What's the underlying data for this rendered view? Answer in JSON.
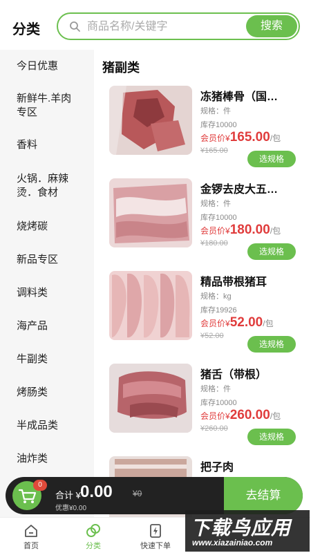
{
  "header": {
    "title": "分类",
    "search_placeholder": "商品名称/关键字",
    "search_button": "搜索"
  },
  "sidebar": {
    "items": [
      {
        "label": "今日优惠"
      },
      {
        "label": "新鲜牛.羊肉专区"
      },
      {
        "label": "香料"
      },
      {
        "label": "火锅．麻辣烫．食材"
      },
      {
        "label": "烧烤碳"
      },
      {
        "label": "新品专区"
      },
      {
        "label": "调料类"
      },
      {
        "label": "海产品"
      },
      {
        "label": "牛副类"
      },
      {
        "label": "烤肠类"
      },
      {
        "label": "半成品类"
      },
      {
        "label": "油炸类"
      }
    ]
  },
  "main": {
    "category_title": "猪副类",
    "products": [
      {
        "name": "冻猪棒骨（国…",
        "spec": "规格：件",
        "stock": "库存10000",
        "member_label": "会员价¥",
        "price": "165.00",
        "unit": "/包",
        "orig_price": "¥165.00",
        "spec_button": "选规格",
        "img_color": "#b8585a"
      },
      {
        "name": "金锣去皮大五…",
        "spec": "规格：件",
        "stock": "库存10000",
        "member_label": "会员价¥",
        "price": "180.00",
        "unit": "/包",
        "orig_price": "¥180.00",
        "spec_button": "选规格",
        "img_color": "#d9a0a4"
      },
      {
        "name": "精品带根猪耳",
        "spec": "规格：kg",
        "stock": "库存19926",
        "member_label": "会员价¥",
        "price": "52.00",
        "unit": "/包",
        "orig_price": "¥52.00",
        "spec_button": "选规格",
        "img_color": "#e6b6b6"
      },
      {
        "name": "猪舌（带根）",
        "spec": "规格：件",
        "stock": "库存10000",
        "member_label": "会员价¥",
        "price": "260.00",
        "unit": "/包",
        "orig_price": "¥260.00",
        "spec_button": "选规格",
        "img_color": "#b7646a"
      },
      {
        "name": "把子肉",
        "spec": "",
        "stock": "",
        "member_label": "",
        "price": "",
        "unit": "",
        "orig_price": "",
        "spec_button": "",
        "img_color": "#caa79c"
      }
    ]
  },
  "cart": {
    "badge": "0",
    "total_label": "合计 ¥",
    "total": "0.00",
    "orig_total": "¥0",
    "discount": "优惠¥0.00",
    "checkout": "去结算"
  },
  "tabbar": {
    "items": [
      {
        "label": "首页",
        "icon": "home-icon"
      },
      {
        "label": "分类",
        "icon": "category-icon"
      },
      {
        "label": "快速下单",
        "icon": "quick-order-icon"
      },
      {
        "label": "",
        "icon": "cart-tab-icon"
      },
      {
        "label": "",
        "icon": "profile-icon"
      }
    ]
  },
  "watermark": {
    "title": "下载鸟应用",
    "url": "www.xiazainiao.com"
  },
  "colors": {
    "accent": "#6bbf4e",
    "price": "#e03c3c",
    "cart_bar": "#222222",
    "badge": "#e04a3a"
  }
}
